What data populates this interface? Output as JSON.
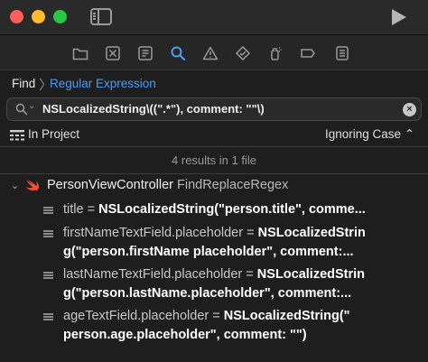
{
  "window": {
    "traffic_lights": [
      "close",
      "minimize",
      "zoom"
    ],
    "run_icon": "play-icon"
  },
  "navigator_tabs": [
    {
      "name": "project",
      "icon": "folder-icon"
    },
    {
      "name": "source-control",
      "icon": "source-control-icon"
    },
    {
      "name": "symbols",
      "icon": "symbol-icon"
    },
    {
      "name": "find",
      "icon": "magnifier-icon",
      "selected": true
    },
    {
      "name": "issues",
      "icon": "warning-icon"
    },
    {
      "name": "tests",
      "icon": "test-diamond-icon"
    },
    {
      "name": "debug",
      "icon": "spray-can-icon"
    },
    {
      "name": "breakpoints",
      "icon": "breakpoint-icon"
    },
    {
      "name": "reports",
      "icon": "report-list-icon"
    }
  ],
  "breadcrumb": {
    "find": "Find",
    "mode": "Regular Expression"
  },
  "search": {
    "query": "NSLocalizedString\\((\".*\"), comment: \"\"\\)"
  },
  "scope": {
    "label": "In Project",
    "case_option": "Ignoring Case ⌃"
  },
  "summary": "4 results in 1 file",
  "group": {
    "file": "PersonViewController",
    "target": "FindReplaceRegex"
  },
  "results": [
    {
      "l1_pre": "title = ",
      "l1_hl": "NSLocalizedString(\"person.title\", comme...",
      "l2_hl": ""
    },
    {
      "l1_pre": "firstNameTextField.placeholder = ",
      "l1_hl": "NSLocalizedStrin",
      "l2_hl": "g(\"person.firstName placeholder\", comment:..."
    },
    {
      "l1_pre": "lastNameTextField.placeholder = ",
      "l1_hl": "NSLocalizedStrin",
      "l2_hl": "g(\"person.lastName.placeholder\", comment:..."
    },
    {
      "l1_pre": "ageTextField.placeholder = ",
      "l1_hl": "NSLocalizedString(\"",
      "l2_hl": "person.age.placeholder\", comment: \"\")"
    }
  ],
  "colors": {
    "accent": "#4d9bf0",
    "background": "#1e1e1e",
    "swift": "#f05138"
  }
}
